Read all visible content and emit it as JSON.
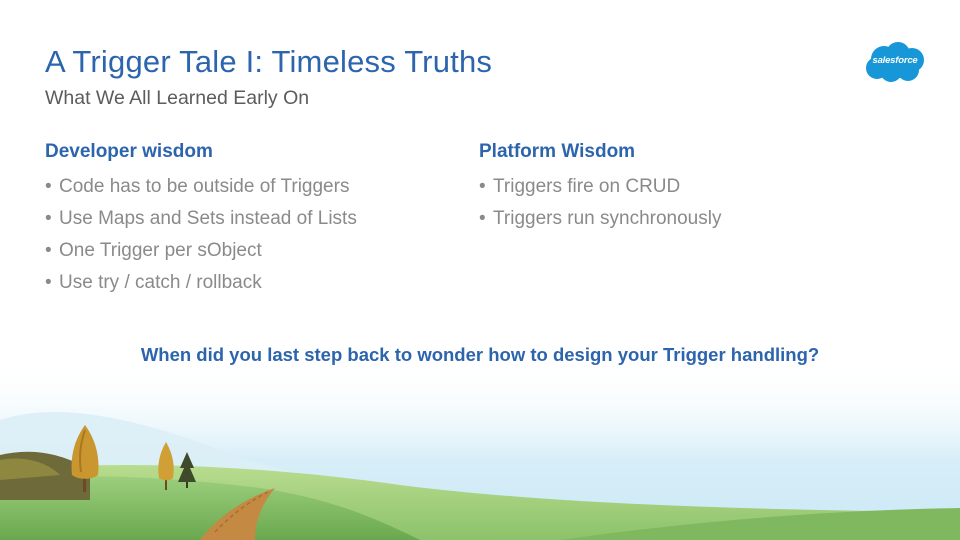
{
  "slide": {
    "title": "A Trigger Tale I: Timeless Truths",
    "subtitle": "What We All Learned Early On",
    "logo_text": "salesforce",
    "bullet_glyph": "•",
    "left_column": {
      "heading": "Developer wisdom",
      "items": [
        "Code has to be outside of Triggers",
        "Use Maps and Sets instead of Lists",
        "One Trigger per sObject",
        "Use try / catch / rollback"
      ]
    },
    "right_column": {
      "heading": "Platform Wisdom",
      "items": [
        "Triggers fire on CRUD",
        "Triggers run synchronously"
      ]
    },
    "question": "When did you last step back to wonder how to design your Trigger handling?"
  },
  "colors": {
    "accent": "#2c64ad",
    "body_text": "#8a8a8a",
    "subtitle_text": "#5c5c5c",
    "logo_blue": "#1797d8"
  },
  "icons": {
    "logo": "salesforce-cloud-logo",
    "illustration": "landscape-with-trees-illustration"
  }
}
